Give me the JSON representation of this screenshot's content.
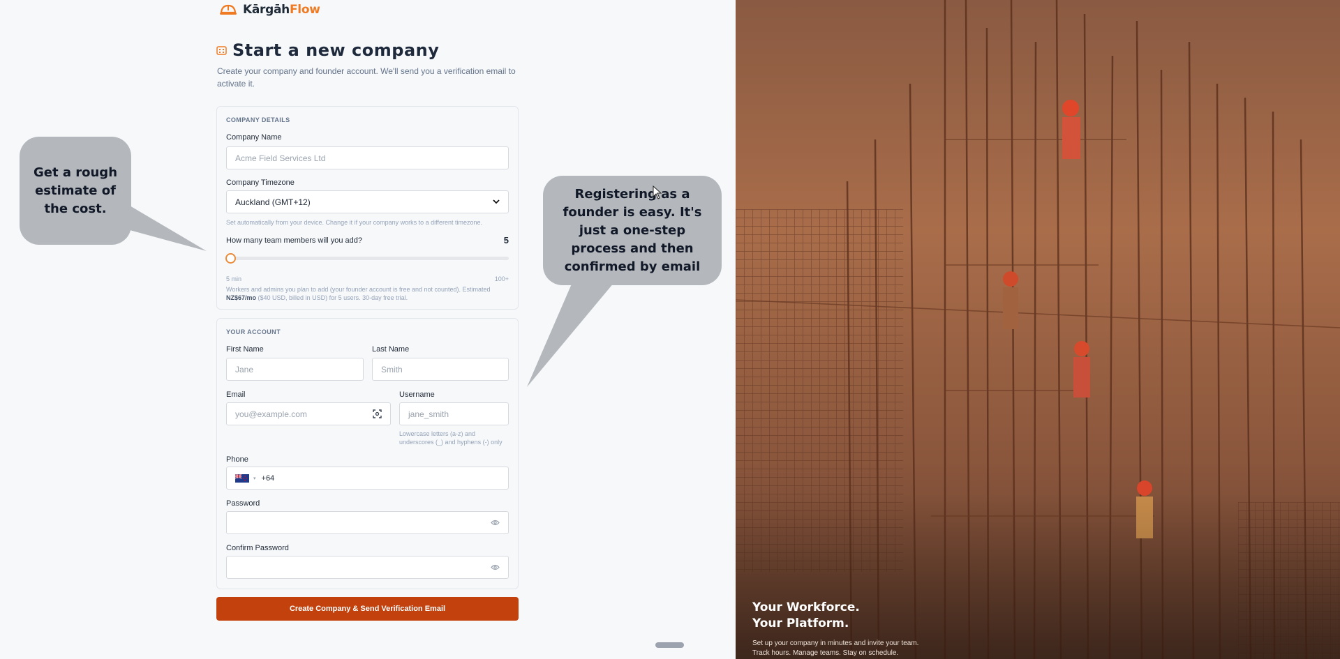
{
  "brand": {
    "name_part1": "Kārgāh",
    "name_part2": "Flow",
    "accent": "#f07a22"
  },
  "page": {
    "title": "Start a new company",
    "subtitle": "Create your company and founder account. We'll send you a verification email to activate it."
  },
  "company_details": {
    "section_label": "COMPANY DETAILS",
    "company_name_label": "Company Name",
    "company_name_placeholder": "Acme Field Services Ltd",
    "timezone_label": "Company Timezone",
    "timezone_value": "Auckland (GMT+12)",
    "timezone_hint": "Set automatically from your device. Change it if your company works to a different timezone.",
    "team_label": "How many team members will you add?",
    "team_count": "5",
    "team_fraction": 0,
    "slider_min_label": "5 min",
    "slider_max_label": "100+",
    "estimate_text_1": "Workers and admins you plan to add (your founder account is free and not counted). Estimated",
    "estimate_price": "NZ$67/mo",
    "estimate_text_2": "($40 USD, billed in USD) for 5 users. 30-day free trial."
  },
  "account": {
    "section_label": "YOUR ACCOUNT",
    "first_name_label": "First Name",
    "first_name_placeholder": "Jane",
    "last_name_label": "Last Name",
    "last_name_placeholder": "Smith",
    "email_label": "Email",
    "email_placeholder": "you@example.com",
    "username_label": "Username",
    "username_placeholder": "jane_smith",
    "username_hint_1": "Lowercase letters (a-z) and",
    "username_hint_2": "underscores (_) and hyphens (-) only",
    "phone_label": "Phone",
    "phone_value": "+64",
    "password_label": "Password",
    "confirm_password_label": "Confirm Password"
  },
  "submit_label": "Create Company & Send Verification Email",
  "callouts": {
    "cost": "Get a rough estimate of the cost.",
    "founder": "Registering as a founder is easy. It's just a one-step process and then confirmed by email"
  },
  "hero": {
    "title_line1": "Your Workforce.",
    "title_line2": "Your Platform.",
    "sub_line1": "Set up your company in minutes and invite your team.",
    "sub_line2": "Track hours. Manage teams. Stay on schedule."
  }
}
